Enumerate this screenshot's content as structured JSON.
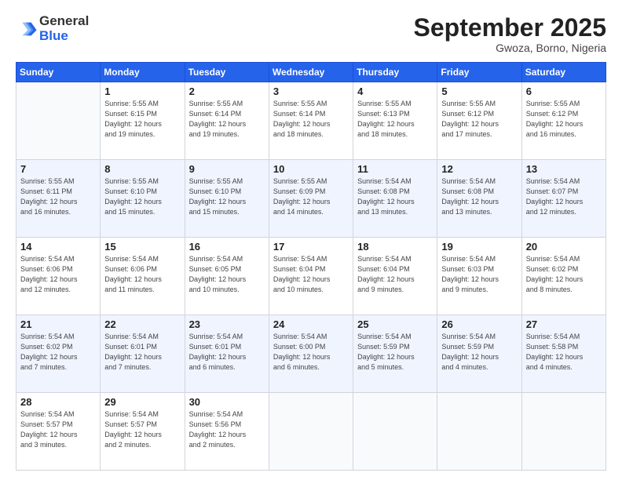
{
  "logo": {
    "general": "General",
    "blue": "Blue"
  },
  "title": "September 2025",
  "location": "Gwoza, Borno, Nigeria",
  "weekdays": [
    "Sunday",
    "Monday",
    "Tuesday",
    "Wednesday",
    "Thursday",
    "Friday",
    "Saturday"
  ],
  "weeks": [
    [
      {
        "day": "",
        "info": ""
      },
      {
        "day": "1",
        "info": "Sunrise: 5:55 AM\nSunset: 6:15 PM\nDaylight: 12 hours\nand 19 minutes."
      },
      {
        "day": "2",
        "info": "Sunrise: 5:55 AM\nSunset: 6:14 PM\nDaylight: 12 hours\nand 19 minutes."
      },
      {
        "day": "3",
        "info": "Sunrise: 5:55 AM\nSunset: 6:14 PM\nDaylight: 12 hours\nand 18 minutes."
      },
      {
        "day": "4",
        "info": "Sunrise: 5:55 AM\nSunset: 6:13 PM\nDaylight: 12 hours\nand 18 minutes."
      },
      {
        "day": "5",
        "info": "Sunrise: 5:55 AM\nSunset: 6:12 PM\nDaylight: 12 hours\nand 17 minutes."
      },
      {
        "day": "6",
        "info": "Sunrise: 5:55 AM\nSunset: 6:12 PM\nDaylight: 12 hours\nand 16 minutes."
      }
    ],
    [
      {
        "day": "7",
        "info": "Sunrise: 5:55 AM\nSunset: 6:11 PM\nDaylight: 12 hours\nand 16 minutes."
      },
      {
        "day": "8",
        "info": "Sunrise: 5:55 AM\nSunset: 6:10 PM\nDaylight: 12 hours\nand 15 minutes."
      },
      {
        "day": "9",
        "info": "Sunrise: 5:55 AM\nSunset: 6:10 PM\nDaylight: 12 hours\nand 15 minutes."
      },
      {
        "day": "10",
        "info": "Sunrise: 5:55 AM\nSunset: 6:09 PM\nDaylight: 12 hours\nand 14 minutes."
      },
      {
        "day": "11",
        "info": "Sunrise: 5:54 AM\nSunset: 6:08 PM\nDaylight: 12 hours\nand 13 minutes."
      },
      {
        "day": "12",
        "info": "Sunrise: 5:54 AM\nSunset: 6:08 PM\nDaylight: 12 hours\nand 13 minutes."
      },
      {
        "day": "13",
        "info": "Sunrise: 5:54 AM\nSunset: 6:07 PM\nDaylight: 12 hours\nand 12 minutes."
      }
    ],
    [
      {
        "day": "14",
        "info": "Sunrise: 5:54 AM\nSunset: 6:06 PM\nDaylight: 12 hours\nand 12 minutes."
      },
      {
        "day": "15",
        "info": "Sunrise: 5:54 AM\nSunset: 6:06 PM\nDaylight: 12 hours\nand 11 minutes."
      },
      {
        "day": "16",
        "info": "Sunrise: 5:54 AM\nSunset: 6:05 PM\nDaylight: 12 hours\nand 10 minutes."
      },
      {
        "day": "17",
        "info": "Sunrise: 5:54 AM\nSunset: 6:04 PM\nDaylight: 12 hours\nand 10 minutes."
      },
      {
        "day": "18",
        "info": "Sunrise: 5:54 AM\nSunset: 6:04 PM\nDaylight: 12 hours\nand 9 minutes."
      },
      {
        "day": "19",
        "info": "Sunrise: 5:54 AM\nSunset: 6:03 PM\nDaylight: 12 hours\nand 9 minutes."
      },
      {
        "day": "20",
        "info": "Sunrise: 5:54 AM\nSunset: 6:02 PM\nDaylight: 12 hours\nand 8 minutes."
      }
    ],
    [
      {
        "day": "21",
        "info": "Sunrise: 5:54 AM\nSunset: 6:02 PM\nDaylight: 12 hours\nand 7 minutes."
      },
      {
        "day": "22",
        "info": "Sunrise: 5:54 AM\nSunset: 6:01 PM\nDaylight: 12 hours\nand 7 minutes."
      },
      {
        "day": "23",
        "info": "Sunrise: 5:54 AM\nSunset: 6:01 PM\nDaylight: 12 hours\nand 6 minutes."
      },
      {
        "day": "24",
        "info": "Sunrise: 5:54 AM\nSunset: 6:00 PM\nDaylight: 12 hours\nand 6 minutes."
      },
      {
        "day": "25",
        "info": "Sunrise: 5:54 AM\nSunset: 5:59 PM\nDaylight: 12 hours\nand 5 minutes."
      },
      {
        "day": "26",
        "info": "Sunrise: 5:54 AM\nSunset: 5:59 PM\nDaylight: 12 hours\nand 4 minutes."
      },
      {
        "day": "27",
        "info": "Sunrise: 5:54 AM\nSunset: 5:58 PM\nDaylight: 12 hours\nand 4 minutes."
      }
    ],
    [
      {
        "day": "28",
        "info": "Sunrise: 5:54 AM\nSunset: 5:57 PM\nDaylight: 12 hours\nand 3 minutes."
      },
      {
        "day": "29",
        "info": "Sunrise: 5:54 AM\nSunset: 5:57 PM\nDaylight: 12 hours\nand 2 minutes."
      },
      {
        "day": "30",
        "info": "Sunrise: 5:54 AM\nSunset: 5:56 PM\nDaylight: 12 hours\nand 2 minutes."
      },
      {
        "day": "",
        "info": ""
      },
      {
        "day": "",
        "info": ""
      },
      {
        "day": "",
        "info": ""
      },
      {
        "day": "",
        "info": ""
      }
    ]
  ]
}
